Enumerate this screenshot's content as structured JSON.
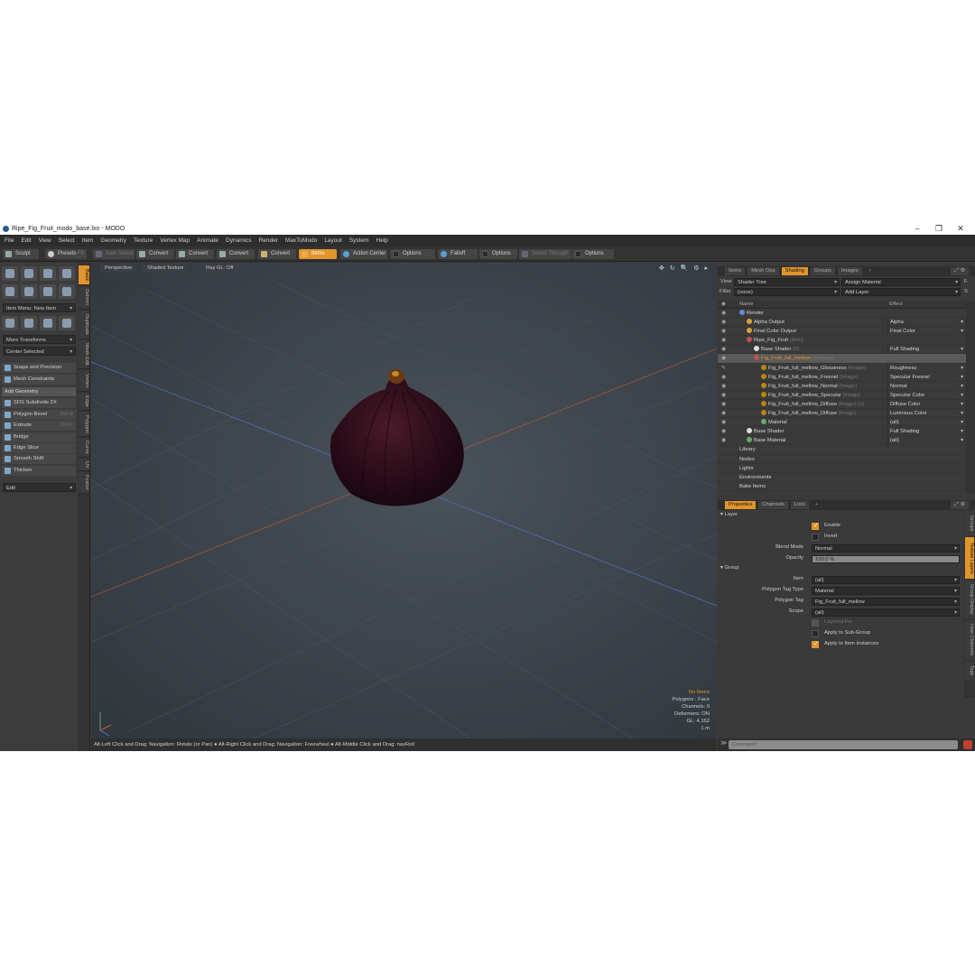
{
  "window": {
    "title": "Ripe_Fig_Fruit_modo_base.lxo - MODO",
    "controls": [
      "–",
      "❐",
      "✕"
    ]
  },
  "menu": [
    "File",
    "Edit",
    "View",
    "Select",
    "Item",
    "Geometry",
    "Texture",
    "Vertex Map",
    "Animate",
    "Dynamics",
    "Render",
    "MaxToModo",
    "Layout",
    "System",
    "Help"
  ],
  "toolbar": {
    "sculpt": "Sculpt",
    "presets": "Presets",
    "presets_key": "F6",
    "auto_select": "Auto Select",
    "convert1": "Convert",
    "convert2": "Convert",
    "convert3": "Convert",
    "convert4": "Convert",
    "items": "Items",
    "action_center": "Action Center",
    "options1": "Options",
    "falloff": "Falloff",
    "options2": "Options",
    "select_through": "Select Through",
    "options3": "Options"
  },
  "left_panel": {
    "item_menu": "Item Menu: New Item",
    "more_transforms": "More Transforms",
    "center_selected": "Center Selected",
    "snaps": "Snaps and Precision",
    "mesh_constraints": "Mesh Constraints",
    "add_geometry": "Add Geometry",
    "tools": [
      {
        "label": "SDS Subdivide 2X",
        "key": ""
      },
      {
        "label": "Polygon Bevel",
        "key": "Shift-B"
      },
      {
        "label": "Extrude",
        "key": "Shift-X"
      },
      {
        "label": "Bridge",
        "key": ""
      },
      {
        "label": "Edge Slice",
        "key": ""
      },
      {
        "label": "Smooth Shift",
        "key": ""
      },
      {
        "label": "Thicken",
        "key": ""
      }
    ],
    "edit": "Edit",
    "vtabs": [
      "Basic",
      "Deform",
      "Duplicate",
      "Mesh Edit",
      "Vertex",
      "Edge",
      "Polygon",
      "Curve",
      "UV",
      "Fusion"
    ]
  },
  "viewport": {
    "perspective": "Perspective",
    "shading": "Shaded Texture",
    "raygl": "Ray GL: Off",
    "icons": "✥ ↻ 🔍 ⚙ ▸",
    "stats": {
      "no_items": "No Items",
      "polygons": "Polygons : Face",
      "channels": "Channels: 0",
      "deformers": "Deformers: ON",
      "gl": "GL: 4,152",
      "scale": "1 m"
    }
  },
  "status_bar": "Alt-Left Click and Drag: Navigation: Rotate (or Pan) ● Alt-Right Click and Drag: Navigation: Freewheel ● Alt-Middle Click and Drag: navRoll",
  "shader_panel": {
    "tabs": [
      "Items",
      "Mesh Ops",
      "Shading",
      "Groups",
      "Images",
      "+"
    ],
    "view_label": "View",
    "view_value": "Shader Tree",
    "assign_material": "Assign Material",
    "f_key": "F",
    "filter_label": "Filter",
    "filter_value": "(none)",
    "add_layer": "Add Layer",
    "s_key": "S",
    "col_name": "Name",
    "col_effect": "Effect",
    "rows": [
      {
        "indent": 0,
        "name": "Render",
        "tag": "",
        "effect": "",
        "eye": "◉",
        "dot": "#5b8fd6"
      },
      {
        "indent": 1,
        "name": "Alpha Output",
        "tag": "",
        "effect": "Alpha",
        "eye": "◉",
        "dot": "#d8a040"
      },
      {
        "indent": 1,
        "name": "Final Color Output",
        "tag": "",
        "effect": "Final Color",
        "eye": "◉",
        "dot": "#d8a040"
      },
      {
        "indent": 1,
        "name": "Ripe_Fig_Fruit",
        "tag": "(Item)",
        "effect": "",
        "eye": "◉",
        "dot": "#c05050"
      },
      {
        "indent": 2,
        "name": "Base Shader",
        "tag": "(2)",
        "effect": "Full Shading",
        "eye": "◉",
        "dot": "#dddddd"
      },
      {
        "indent": 2,
        "name": "Fig_Fruit_full_mellow",
        "tag": "(Material)",
        "effect": "",
        "eye": "◉",
        "dot": "#c05050",
        "selected": true
      },
      {
        "indent": 3,
        "name": "Fig_Fruit_full_mellow_Glossiness",
        "tag": "(Image)",
        "effect": "Roughness",
        "eye": "✎",
        "dot": "#b8860b"
      },
      {
        "indent": 3,
        "name": "Fig_Fruit_full_mellow_Fresnel",
        "tag": "(Image)",
        "effect": "Specular Fresnel",
        "eye": "◉",
        "dot": "#b8860b"
      },
      {
        "indent": 3,
        "name": "Fig_Fruit_full_mellow_Normal",
        "tag": "(Image)",
        "effect": "Normal",
        "eye": "◉",
        "dot": "#b8860b"
      },
      {
        "indent": 3,
        "name": "Fig_Fruit_full_mellow_Specular",
        "tag": "(Image)",
        "effect": "Specular Color",
        "eye": "◉",
        "dot": "#b8860b"
      },
      {
        "indent": 3,
        "name": "Fig_Fruit_full_mellow_Diffuse",
        "tag": "(Image) (2)",
        "effect": "Diffuse Color",
        "eye": "◉",
        "dot": "#b8860b"
      },
      {
        "indent": 3,
        "name": "Fig_Fruit_full_mellow_Diffuse",
        "tag": "(Image)",
        "effect": "Luminous Color",
        "eye": "◉",
        "dot": "#b8860b"
      },
      {
        "indent": 3,
        "name": "Material",
        "tag": "",
        "effect": "(all)",
        "eye": "◉",
        "dot": "#6aa86a"
      },
      {
        "indent": 1,
        "name": "Base Shader",
        "tag": "",
        "effect": "Full Shading",
        "eye": "◉",
        "dot": "#dddddd"
      },
      {
        "indent": 1,
        "name": "Base Material",
        "tag": "",
        "effect": "(all)",
        "eye": "◉",
        "dot": "#6aa86a"
      },
      {
        "indent": 0,
        "name": "Library",
        "tag": "",
        "effect": "",
        "eye": "",
        "dot": ""
      },
      {
        "indent": 0,
        "name": "Nodes",
        "tag": "",
        "effect": "",
        "eye": "",
        "dot": ""
      },
      {
        "indent": 0,
        "name": "Lights",
        "tag": "",
        "effect": "",
        "eye": "",
        "dot": ""
      },
      {
        "indent": 0,
        "name": "Environments",
        "tag": "",
        "effect": "",
        "eye": "",
        "dot": ""
      },
      {
        "indent": 0,
        "name": "Bake Items",
        "tag": "",
        "effect": "",
        "eye": "",
        "dot": ""
      }
    ]
  },
  "properties": {
    "tabs": [
      "Properties",
      "Channels",
      "Lists",
      "+"
    ],
    "layer_section": "Layer",
    "enable": "Enable",
    "invert": "Invert",
    "blend_mode_label": "Blend Mode",
    "blend_mode": "Normal",
    "opacity_label": "Opacity",
    "opacity": "100.0 %",
    "group_section": "Group",
    "item_label": "Item",
    "item": "(all)",
    "ptt_label": "Polygon Tag Type",
    "ptt": "Material",
    "pt_label": "Polygon Tag",
    "pt": "Fig_Fruit_full_mellow",
    "scope_label": "Scope",
    "scope": "(all)",
    "layered_fur": "Layered Fur",
    "apply_sub": "Apply to Sub-Group",
    "apply_inst": "Apply to Item Instances",
    "side_tabs": [
      "Groups",
      "Texture Layers",
      "Group Display",
      "User Channels",
      "Tags"
    ]
  },
  "command": {
    "placeholder": "Command",
    "symbol": "≫"
  }
}
